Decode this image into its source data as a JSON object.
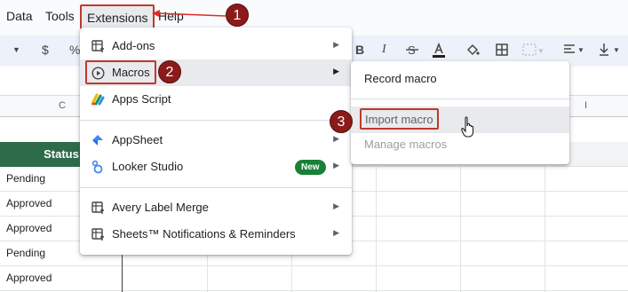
{
  "menubar": {
    "items": [
      "Data",
      "Tools",
      "Extensions",
      "Help"
    ]
  },
  "toolbar": {
    "currency": "$",
    "percent": "%",
    "bold": "B",
    "italic": "I"
  },
  "columns": {
    "c_letter": "C",
    "i_letter": "I"
  },
  "sheet": {
    "status_header": "Status",
    "rows": [
      "Pending",
      "Approved",
      "Approved",
      "Pending",
      "Approved"
    ]
  },
  "extensions_menu": {
    "items": [
      {
        "label": "Add-ons",
        "icon": "addons-icon"
      },
      {
        "label": "Macros",
        "icon": "macros-play-icon"
      },
      {
        "label": "Apps Script",
        "icon": "apps-script-icon"
      },
      {
        "label": "AppSheet",
        "icon": "appsheet-icon"
      },
      {
        "label": "Looker Studio",
        "icon": "looker-studio-icon",
        "badge": "New"
      },
      {
        "label": "Avery Label Merge",
        "icon": "addons-icon"
      },
      {
        "label": "Sheets™ Notifications & Reminders",
        "icon": "addons-icon"
      }
    ]
  },
  "macros_menu": {
    "items": [
      "Record macro",
      "Import macro",
      "Manage macros"
    ]
  },
  "steps": [
    "1",
    "2",
    "3"
  ],
  "colors": {
    "accent_red": "#c0392b",
    "step_marker": "#8b1a1a",
    "status_header_bg": "#2e6b4a",
    "new_badge": "#188038"
  }
}
